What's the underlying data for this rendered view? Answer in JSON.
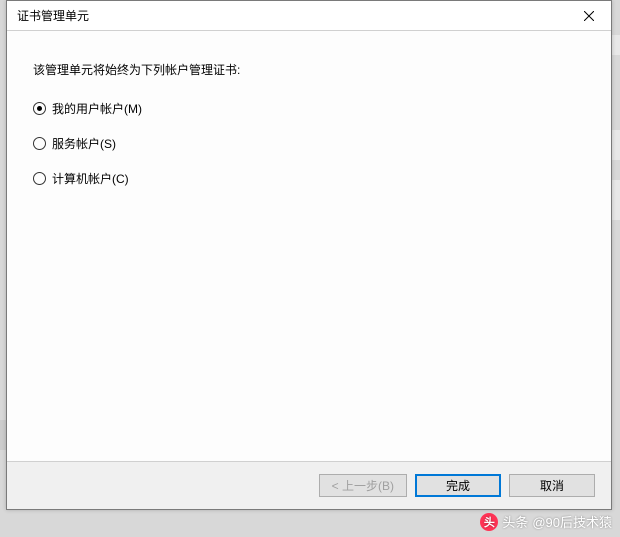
{
  "titlebar": {
    "title": "证书管理单元"
  },
  "content": {
    "instruction": "该管理单元将始终为下列帐户管理证书:",
    "options": [
      {
        "label": "我的用户帐户(M)",
        "selected": true
      },
      {
        "label": "服务帐户(S)",
        "selected": false
      },
      {
        "label": "计算机帐户(C)",
        "selected": false
      }
    ]
  },
  "footer": {
    "back_label": "< 上一步(B)",
    "finish_label": "完成",
    "cancel_label": "取消"
  },
  "watermark": {
    "prefix": "头条",
    "handle": "@90后技术猿"
  }
}
